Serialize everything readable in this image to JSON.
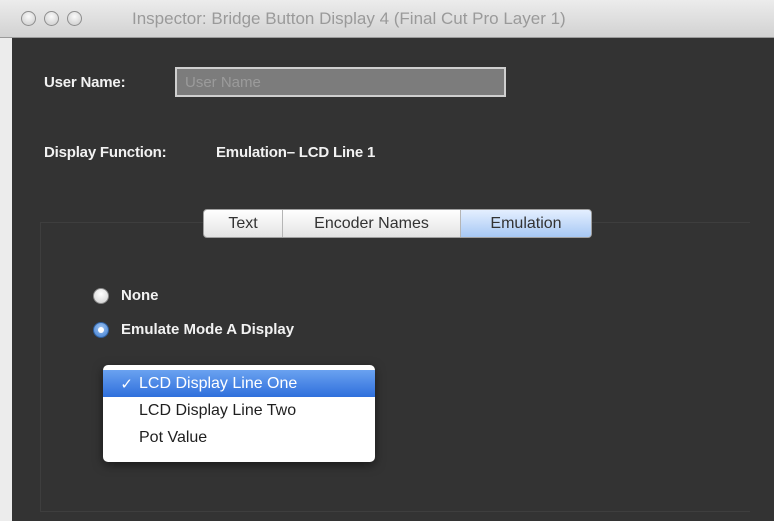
{
  "window": {
    "title": "Inspector: Bridge Button Display 4 (Final Cut Pro Layer 1)"
  },
  "form": {
    "user_name_label": "User Name:",
    "user_name_value": "",
    "user_name_placeholder": "User Name",
    "display_function_label": "Display Function:",
    "display_function_value": "Emulation– LCD Line 1"
  },
  "tabs": [
    {
      "label": "Text",
      "selected": false
    },
    {
      "label": "Encoder Names",
      "selected": false
    },
    {
      "label": "Emulation",
      "selected": true
    }
  ],
  "radios": [
    {
      "label": "None",
      "checked": false
    },
    {
      "label": "Emulate Mode A Display",
      "checked": true
    }
  ],
  "dropdown": {
    "options": [
      {
        "label": "LCD Display Line One",
        "checked": true,
        "check_mark": "✓"
      },
      {
        "label": "LCD Display Line Two",
        "checked": false,
        "check_mark": ""
      },
      {
        "label": "Pot Value",
        "checked": false,
        "check_mark": ""
      }
    ]
  },
  "colors": {
    "background": "#333333",
    "selection": "#2f6fdc",
    "title_text": "#9a9a9a"
  }
}
